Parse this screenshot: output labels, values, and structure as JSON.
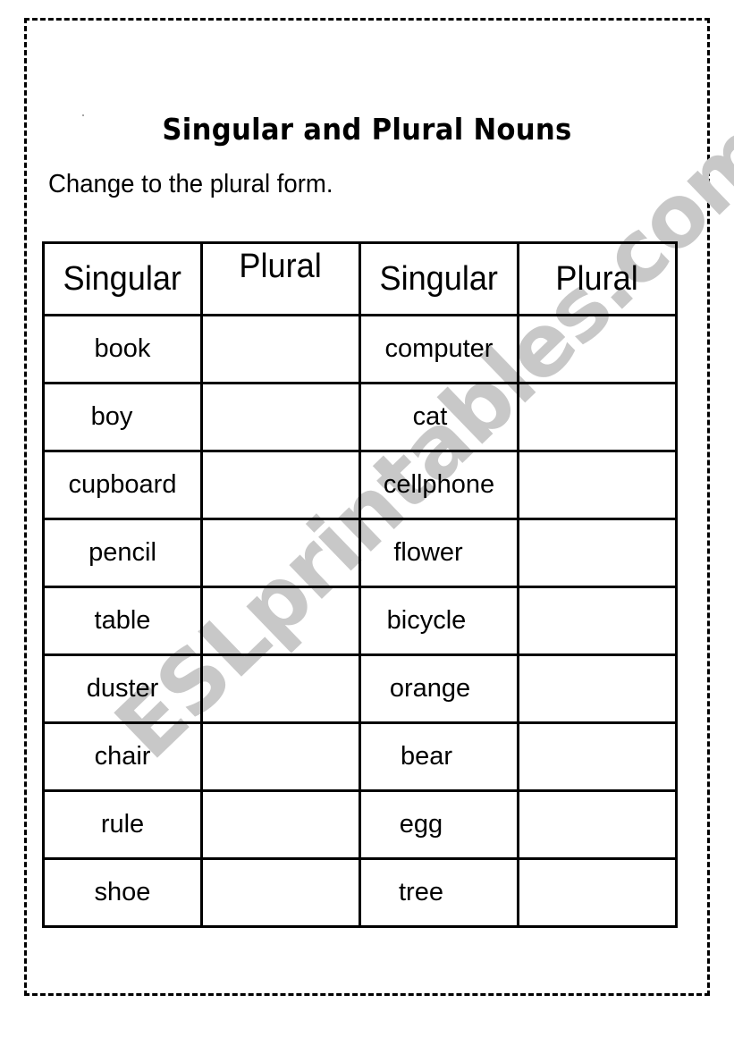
{
  "title": "Singular and Plural Nouns",
  "instruction": "Change to the plural form.",
  "watermark": "ESLprintables.com",
  "table": {
    "headers": [
      "Singular",
      "Plural",
      "Singular",
      "Plural"
    ],
    "rows": [
      {
        "left": "book",
        "left_plural": "",
        "right": "computer",
        "right_plural": ""
      },
      {
        "left": "boy",
        "left_plural": "",
        "right": "cat",
        "right_plural": ""
      },
      {
        "left": "cupboard",
        "left_plural": "",
        "right": "cellphone",
        "right_plural": ""
      },
      {
        "left": "pencil",
        "left_plural": "",
        "right": "flower",
        "right_plural": ""
      },
      {
        "left": "table",
        "left_plural": "",
        "right": "bicycle",
        "right_plural": ""
      },
      {
        "left": "duster",
        "left_plural": "",
        "right": "orange",
        "right_plural": ""
      },
      {
        "left": "chair",
        "left_plural": "",
        "right": "bear",
        "right_plural": ""
      },
      {
        "left": "rule",
        "left_plural": "",
        "right": "egg",
        "right_plural": ""
      },
      {
        "left": "shoe",
        "left_plural": "",
        "right": "tree",
        "right_plural": ""
      }
    ]
  }
}
